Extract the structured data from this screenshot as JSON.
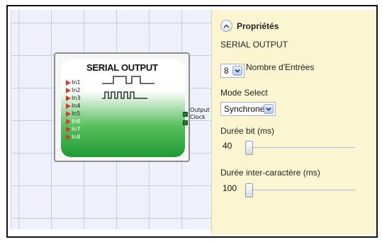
{
  "block": {
    "title": "SERIAL OUTPUT",
    "inputs": [
      "In1",
      "In2",
      "In3",
      "In4",
      "In5",
      "In6",
      "In7",
      "In8"
    ],
    "outputs": [
      "Output",
      "Clock"
    ]
  },
  "properties": {
    "title": "Propriétés",
    "subtitle": "SERIAL OUTPUT",
    "nombre_entrees": {
      "value": "8",
      "label": "Nombre d'Entrées"
    },
    "mode_select": {
      "label": "Mode Select",
      "value": "Synchrone"
    },
    "duree_bit": {
      "label": "Durée bit (ms)",
      "value": "40",
      "slider_fraction": 0.0
    },
    "duree_inter": {
      "label": "Durée inter-caractère (ms)",
      "value": "100",
      "slider_fraction": 0.0
    }
  },
  "colors": {
    "input_port": "#e0362c",
    "block_gradient_bottom": "#1f9a35",
    "panel_background": "#fbf6d1",
    "canvas_background": "#eef0fb"
  },
  "icons": [
    "collapse-up-icon",
    "dropdown-arrow-icon",
    "pulse-wave-icon",
    "clock-wave-icon"
  ]
}
